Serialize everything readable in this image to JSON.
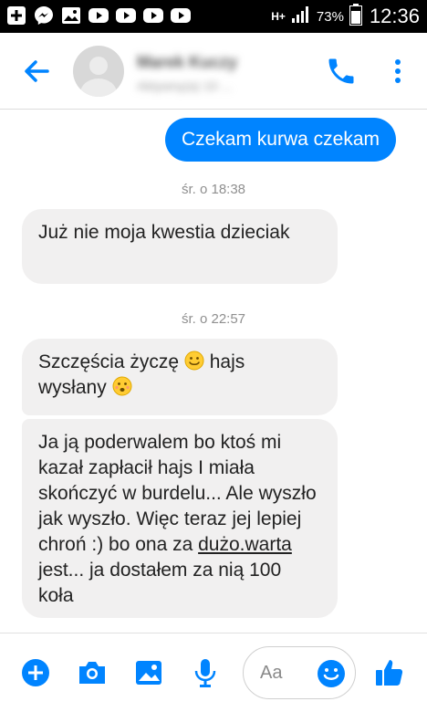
{
  "status_bar": {
    "network": "H+",
    "battery": "73%",
    "time": "12:36"
  },
  "header": {
    "contact_name": "Marek Kuczy",
    "contact_status": "Aktywny(a) 10 ..."
  },
  "messages": {
    "outgoing_1": "Czekam kurwa czekam",
    "timestamp_1": "śr. o 18:38",
    "incoming_1": "Już nie moja kwestia dzieciak",
    "timestamp_2": "śr. o 22:57",
    "incoming_2_part1": "Szczęścia życzę",
    "incoming_2_part2": "hajs",
    "incoming_2_part3": "wysłany",
    "incoming_3_part1": "Ja ją poderwalem   bo ktoś mi kazał zapłacił hajs I miała skończyć w burdelu... Ale wyszło jak wyszło. Więc teraz jej lepiej chroń  :) bo ona za ",
    "incoming_3_link": "dużo.warta",
    "incoming_3_part2": " jest... ja dostałem za nią 100 koła"
  },
  "composer": {
    "placeholder": "Aa"
  },
  "colors": {
    "accent": "#0084ff",
    "incoming_bubble": "#f1f0f0",
    "status_bar": "#000000"
  },
  "icons": {
    "status_left": [
      "plus-square-icon",
      "messenger-icon",
      "image-icon",
      "youtube-icon",
      "youtube-icon",
      "youtube-icon",
      "youtube-icon"
    ],
    "header": [
      "back-arrow-icon",
      "phone-icon",
      "more-vertical-icon"
    ],
    "composer": [
      "plus-circle-icon",
      "camera-icon",
      "image-icon",
      "microphone-icon",
      "emoji-icon",
      "thumbs-up-icon"
    ]
  }
}
